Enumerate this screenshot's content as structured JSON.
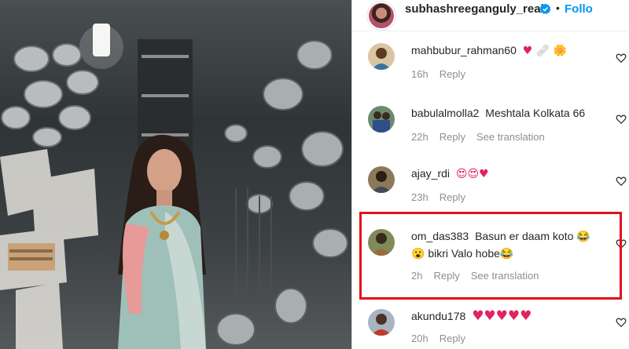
{
  "post": {
    "username": "subhashreeganguly_real",
    "separator": "•",
    "follow_label": "Follo",
    "verified_icon": "verified-badge-icon",
    "accent_color": "#0095f6"
  },
  "comments": [
    {
      "username": "mahbubur_rahman60",
      "text": "♥ 🩹 🌼",
      "time": "16h",
      "reply": "Reply",
      "translation": ""
    },
    {
      "username": "babulalmolla2",
      "text": "Meshtala Kolkata 66",
      "time": "22h",
      "reply": "Reply",
      "translation": "See translation"
    },
    {
      "username": "ajay_rdi",
      "text": "😍😍♥",
      "time": "23h",
      "reply": "Reply",
      "translation": ""
    },
    {
      "username": "om_das383",
      "text": "Basun er daam koto 😂",
      "text2": "😮 bikri Valo hobe😂",
      "time": "2h",
      "reply": "Reply",
      "translation": "See translation",
      "highlighted": true
    },
    {
      "username": "akundu178",
      "text": "♥♥♥♥♥",
      "time": "20h",
      "reply": "Reply",
      "translation": ""
    }
  ],
  "highlight_color": "#e2111b"
}
